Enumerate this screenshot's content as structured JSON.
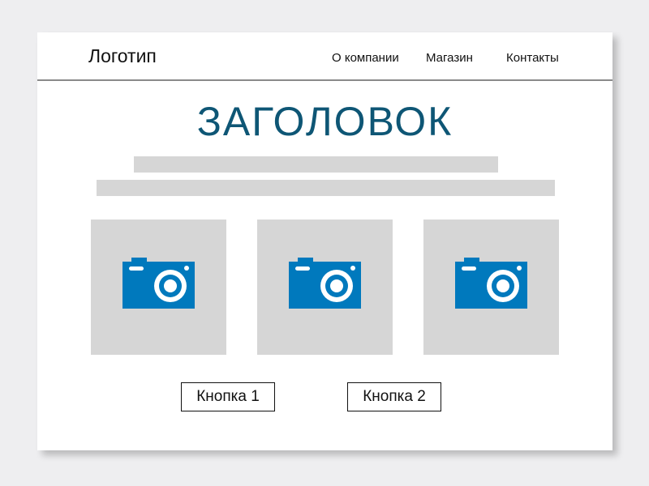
{
  "header": {
    "logo": "Логотип",
    "nav": [
      {
        "label": "О компании"
      },
      {
        "label": "Магазин"
      },
      {
        "label": "Контакты"
      }
    ]
  },
  "main": {
    "headline": "ЗАГОЛОВОК",
    "text_placeholder_lines": 2,
    "images": [
      {
        "icon": "camera-icon"
      },
      {
        "icon": "camera-icon"
      },
      {
        "icon": "camera-icon"
      }
    ],
    "buttons": [
      {
        "label": "Кнопка 1"
      },
      {
        "label": "Кнопка 2"
      }
    ]
  },
  "colors": {
    "background": "#eeeef0",
    "headline": "#0e5675",
    "placeholder": "#d6d6d6",
    "icon": "#0079bd"
  }
}
